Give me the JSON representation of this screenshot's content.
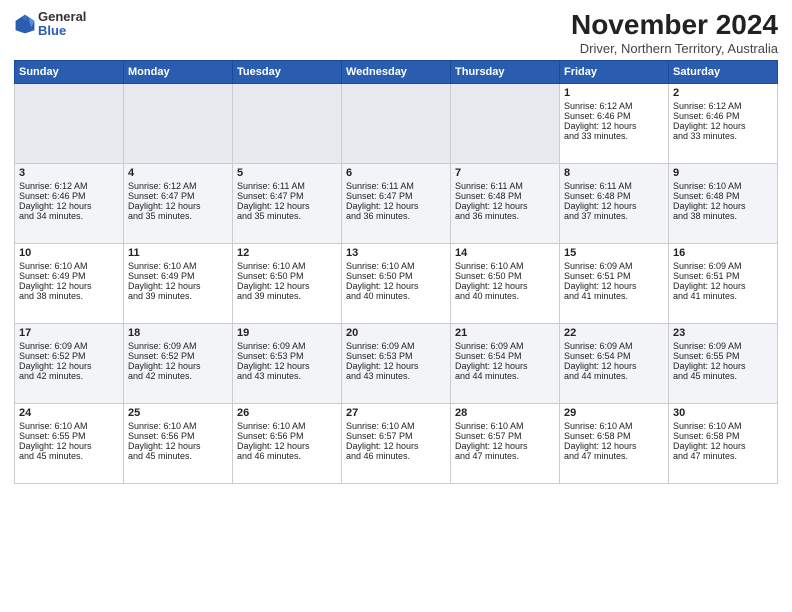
{
  "header": {
    "logo_general": "General",
    "logo_blue": "Blue",
    "month_title": "November 2024",
    "subtitle": "Driver, Northern Territory, Australia"
  },
  "days_of_week": [
    "Sunday",
    "Monday",
    "Tuesday",
    "Wednesday",
    "Thursday",
    "Friday",
    "Saturday"
  ],
  "weeks": [
    [
      {
        "day": "",
        "info": ""
      },
      {
        "day": "",
        "info": ""
      },
      {
        "day": "",
        "info": ""
      },
      {
        "day": "",
        "info": ""
      },
      {
        "day": "",
        "info": ""
      },
      {
        "day": "1",
        "info": "Sunrise: 6:12 AM\nSunset: 6:46 PM\nDaylight: 12 hours\nand 33 minutes."
      },
      {
        "day": "2",
        "info": "Sunrise: 6:12 AM\nSunset: 6:46 PM\nDaylight: 12 hours\nand 33 minutes."
      }
    ],
    [
      {
        "day": "3",
        "info": "Sunrise: 6:12 AM\nSunset: 6:46 PM\nDaylight: 12 hours\nand 34 minutes."
      },
      {
        "day": "4",
        "info": "Sunrise: 6:12 AM\nSunset: 6:47 PM\nDaylight: 12 hours\nand 35 minutes."
      },
      {
        "day": "5",
        "info": "Sunrise: 6:11 AM\nSunset: 6:47 PM\nDaylight: 12 hours\nand 35 minutes."
      },
      {
        "day": "6",
        "info": "Sunrise: 6:11 AM\nSunset: 6:47 PM\nDaylight: 12 hours\nand 36 minutes."
      },
      {
        "day": "7",
        "info": "Sunrise: 6:11 AM\nSunset: 6:48 PM\nDaylight: 12 hours\nand 36 minutes."
      },
      {
        "day": "8",
        "info": "Sunrise: 6:11 AM\nSunset: 6:48 PM\nDaylight: 12 hours\nand 37 minutes."
      },
      {
        "day": "9",
        "info": "Sunrise: 6:10 AM\nSunset: 6:48 PM\nDaylight: 12 hours\nand 38 minutes."
      }
    ],
    [
      {
        "day": "10",
        "info": "Sunrise: 6:10 AM\nSunset: 6:49 PM\nDaylight: 12 hours\nand 38 minutes."
      },
      {
        "day": "11",
        "info": "Sunrise: 6:10 AM\nSunset: 6:49 PM\nDaylight: 12 hours\nand 39 minutes."
      },
      {
        "day": "12",
        "info": "Sunrise: 6:10 AM\nSunset: 6:50 PM\nDaylight: 12 hours\nand 39 minutes."
      },
      {
        "day": "13",
        "info": "Sunrise: 6:10 AM\nSunset: 6:50 PM\nDaylight: 12 hours\nand 40 minutes."
      },
      {
        "day": "14",
        "info": "Sunrise: 6:10 AM\nSunset: 6:50 PM\nDaylight: 12 hours\nand 40 minutes."
      },
      {
        "day": "15",
        "info": "Sunrise: 6:09 AM\nSunset: 6:51 PM\nDaylight: 12 hours\nand 41 minutes."
      },
      {
        "day": "16",
        "info": "Sunrise: 6:09 AM\nSunset: 6:51 PM\nDaylight: 12 hours\nand 41 minutes."
      }
    ],
    [
      {
        "day": "17",
        "info": "Sunrise: 6:09 AM\nSunset: 6:52 PM\nDaylight: 12 hours\nand 42 minutes."
      },
      {
        "day": "18",
        "info": "Sunrise: 6:09 AM\nSunset: 6:52 PM\nDaylight: 12 hours\nand 42 minutes."
      },
      {
        "day": "19",
        "info": "Sunrise: 6:09 AM\nSunset: 6:53 PM\nDaylight: 12 hours\nand 43 minutes."
      },
      {
        "day": "20",
        "info": "Sunrise: 6:09 AM\nSunset: 6:53 PM\nDaylight: 12 hours\nand 43 minutes."
      },
      {
        "day": "21",
        "info": "Sunrise: 6:09 AM\nSunset: 6:54 PM\nDaylight: 12 hours\nand 44 minutes."
      },
      {
        "day": "22",
        "info": "Sunrise: 6:09 AM\nSunset: 6:54 PM\nDaylight: 12 hours\nand 44 minutes."
      },
      {
        "day": "23",
        "info": "Sunrise: 6:09 AM\nSunset: 6:55 PM\nDaylight: 12 hours\nand 45 minutes."
      }
    ],
    [
      {
        "day": "24",
        "info": "Sunrise: 6:10 AM\nSunset: 6:55 PM\nDaylight: 12 hours\nand 45 minutes."
      },
      {
        "day": "25",
        "info": "Sunrise: 6:10 AM\nSunset: 6:56 PM\nDaylight: 12 hours\nand 45 minutes."
      },
      {
        "day": "26",
        "info": "Sunrise: 6:10 AM\nSunset: 6:56 PM\nDaylight: 12 hours\nand 46 minutes."
      },
      {
        "day": "27",
        "info": "Sunrise: 6:10 AM\nSunset: 6:57 PM\nDaylight: 12 hours\nand 46 minutes."
      },
      {
        "day": "28",
        "info": "Sunrise: 6:10 AM\nSunset: 6:57 PM\nDaylight: 12 hours\nand 47 minutes."
      },
      {
        "day": "29",
        "info": "Sunrise: 6:10 AM\nSunset: 6:58 PM\nDaylight: 12 hours\nand 47 minutes."
      },
      {
        "day": "30",
        "info": "Sunrise: 6:10 AM\nSunset: 6:58 PM\nDaylight: 12 hours\nand 47 minutes."
      }
    ]
  ]
}
